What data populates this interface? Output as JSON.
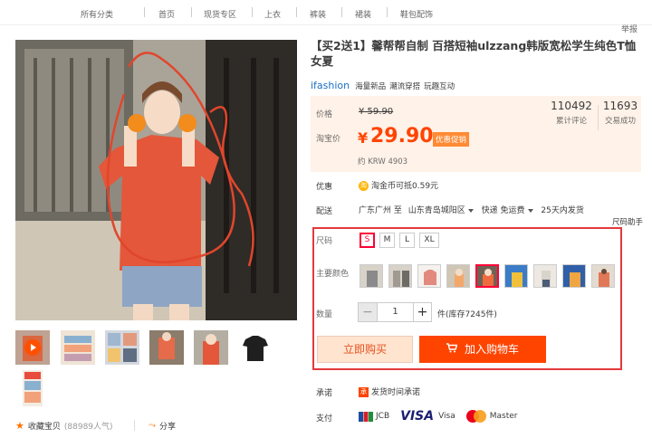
{
  "nav": {
    "items": [
      "所有分类",
      "首页",
      "现货专区",
      "上衣",
      "裤装",
      "裙装",
      "鞋包配饰"
    ],
    "report": "举报"
  },
  "product": {
    "title": "【买2送1】馨帮帮自制 百搭短袖ulzzang韩版宽松学生纯色T恤女夏",
    "brand": "ifashion",
    "brand_tags": [
      "海量新品",
      "潮流穿搭",
      "玩趣互动"
    ]
  },
  "price": {
    "label_original": "价格",
    "original": "¥ 59.90",
    "label_taobao": "淘宝价",
    "currency": "¥",
    "current": "29.90",
    "promo_badge": "优惠促销",
    "krw": "约 KRW 4903",
    "stats": [
      {
        "value": "110492",
        "label": "累计评论"
      },
      {
        "value": "11693",
        "label": "交易成功"
      }
    ]
  },
  "discount": {
    "label": "优惠",
    "coin": "淘",
    "text": "淘金币可抵0.59元"
  },
  "shipping": {
    "label": "配送",
    "from": "广东广州 至",
    "to": "山东青岛城阳区",
    "method": "快递 免运费",
    "time": "25天内发货",
    "helper": "尺码助手"
  },
  "sku": {
    "size_label": "尺码",
    "sizes": [
      "S",
      "M",
      "L",
      "XL"
    ],
    "selected_size": "S",
    "color_label": "主要颜色",
    "colors": [
      {
        "name": "colorway-1",
        "fill": "#8a8a8a"
      },
      {
        "name": "colorway-2",
        "fill": "#a19a92"
      },
      {
        "name": "colorway-3",
        "fill": "#e38a7e"
      },
      {
        "name": "colorway-4",
        "fill": "#f3a86a"
      },
      {
        "name": "colorway-5",
        "fill": "#ef6a3c"
      },
      {
        "name": "colorway-6",
        "fill": "#f1c03a"
      },
      {
        "name": "colorway-7",
        "fill": "#d8d3cb"
      },
      {
        "name": "colorway-8",
        "fill": "#f0a640"
      },
      {
        "name": "colorway-9",
        "fill": "#e07858"
      }
    ],
    "qty_label": "数量",
    "qty_minus": "−",
    "qty": "1",
    "qty_plus": "+",
    "stock": "件(库存7245件)",
    "buy_now": "立即购买",
    "add_cart": "加入购物车",
    "cart_icon": "cart-icon"
  },
  "promise": {
    "label": "承诺",
    "icon": "承",
    "text": "发货时间承诺"
  },
  "payment": {
    "label": "支付",
    "jcb": "JCB",
    "visa": "VISA",
    "visa_text": "Visa",
    "master": "Master"
  },
  "social": {
    "fav": "收藏宝贝",
    "fav_count": "(88989人气)",
    "share": "分享"
  },
  "colors": {
    "accent": "#ff4400",
    "sku_border": "#e4393c",
    "price_bg": "#fff2e8"
  }
}
